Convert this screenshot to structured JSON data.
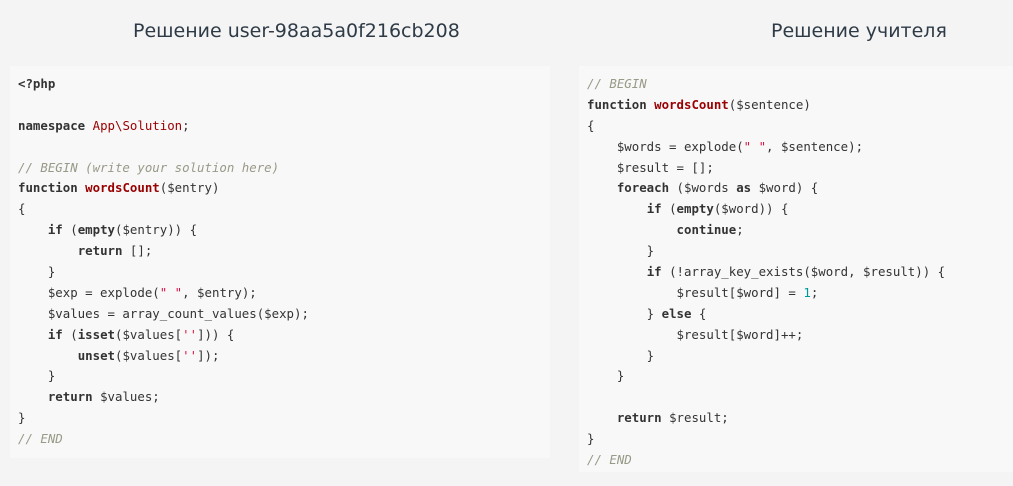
{
  "headings": {
    "student": "Решение user-98aa5a0f216cb208",
    "teacher": "Решение учителя"
  },
  "colors": {
    "background": "#f4f4f4",
    "panel": "#f8f8f8",
    "keyword": "#333333",
    "function_name": "#990000",
    "comment": "#999988",
    "string": "#dd1144",
    "number": "#009999"
  },
  "student_code": [
    [
      [
        "kw",
        "<?php"
      ]
    ],
    [],
    [
      [
        "kw",
        "namespace "
      ],
      [
        "ns",
        "App\\Solution"
      ],
      [
        "plain",
        ";"
      ]
    ],
    [],
    [
      [
        "cm",
        "// BEGIN (write your solution here)"
      ]
    ],
    [
      [
        "kw",
        "function "
      ],
      [
        "fn",
        "wordsCount"
      ],
      [
        "plain",
        "($entry)"
      ]
    ],
    [
      [
        "plain",
        "{"
      ]
    ],
    [
      [
        "plain",
        "    "
      ],
      [
        "kw",
        "if"
      ],
      [
        "plain",
        " ("
      ],
      [
        "kw",
        "empty"
      ],
      [
        "plain",
        "($entry)) {"
      ]
    ],
    [
      [
        "plain",
        "        "
      ],
      [
        "kw",
        "return"
      ],
      [
        "plain",
        " [];"
      ]
    ],
    [
      [
        "plain",
        "    }"
      ]
    ],
    [
      [
        "plain",
        "    $exp = explode("
      ],
      [
        "str",
        "\" \""
      ],
      [
        "plain",
        ", $entry);"
      ]
    ],
    [
      [
        "plain",
        "    $values = array_count_values($exp);"
      ]
    ],
    [
      [
        "plain",
        "    "
      ],
      [
        "kw",
        "if"
      ],
      [
        "plain",
        " ("
      ],
      [
        "kw",
        "isset"
      ],
      [
        "plain",
        "($values["
      ],
      [
        "str",
        "''"
      ],
      [
        "plain",
        "])) {"
      ]
    ],
    [
      [
        "plain",
        "        "
      ],
      [
        "kw",
        "unset"
      ],
      [
        "plain",
        "($values["
      ],
      [
        "str",
        "''"
      ],
      [
        "plain",
        "]);"
      ]
    ],
    [
      [
        "plain",
        "    }"
      ]
    ],
    [
      [
        "plain",
        "    "
      ],
      [
        "kw",
        "return"
      ],
      [
        "plain",
        " $values;"
      ]
    ],
    [
      [
        "plain",
        "}"
      ]
    ],
    [
      [
        "cm",
        "// END"
      ]
    ]
  ],
  "teacher_code": [
    [
      [
        "cm",
        "// BEGIN"
      ]
    ],
    [
      [
        "kw",
        "function "
      ],
      [
        "fn",
        "wordsCount"
      ],
      [
        "plain",
        "($sentence)"
      ]
    ],
    [
      [
        "plain",
        "{"
      ]
    ],
    [
      [
        "plain",
        "    $words = explode("
      ],
      [
        "str",
        "\" \""
      ],
      [
        "plain",
        ", $sentence);"
      ]
    ],
    [
      [
        "plain",
        "    $result = [];"
      ]
    ],
    [
      [
        "plain",
        "    "
      ],
      [
        "kw",
        "foreach"
      ],
      [
        "plain",
        " ($words "
      ],
      [
        "kw",
        "as"
      ],
      [
        "plain",
        " $word) {"
      ]
    ],
    [
      [
        "plain",
        "        "
      ],
      [
        "kw",
        "if"
      ],
      [
        "plain",
        " ("
      ],
      [
        "kw",
        "empty"
      ],
      [
        "plain",
        "($word)) {"
      ]
    ],
    [
      [
        "plain",
        "            "
      ],
      [
        "kw",
        "continue"
      ],
      [
        "plain",
        ";"
      ]
    ],
    [
      [
        "plain",
        "        }"
      ]
    ],
    [
      [
        "plain",
        "        "
      ],
      [
        "kw",
        "if"
      ],
      [
        "plain",
        " (!array_key_exists($word, $result)) {"
      ]
    ],
    [
      [
        "plain",
        "            $result[$word] = "
      ],
      [
        "num",
        "1"
      ],
      [
        "plain",
        ";"
      ]
    ],
    [
      [
        "plain",
        "        } "
      ],
      [
        "kw",
        "else"
      ],
      [
        "plain",
        " {"
      ]
    ],
    [
      [
        "plain",
        "            $result[$word]++;"
      ]
    ],
    [
      [
        "plain",
        "        }"
      ]
    ],
    [
      [
        "plain",
        "    }"
      ]
    ],
    [],
    [
      [
        "plain",
        "    "
      ],
      [
        "kw",
        "return"
      ],
      [
        "plain",
        " $result;"
      ]
    ],
    [
      [
        "plain",
        "}"
      ]
    ],
    [
      [
        "cm",
        "// END"
      ]
    ]
  ]
}
